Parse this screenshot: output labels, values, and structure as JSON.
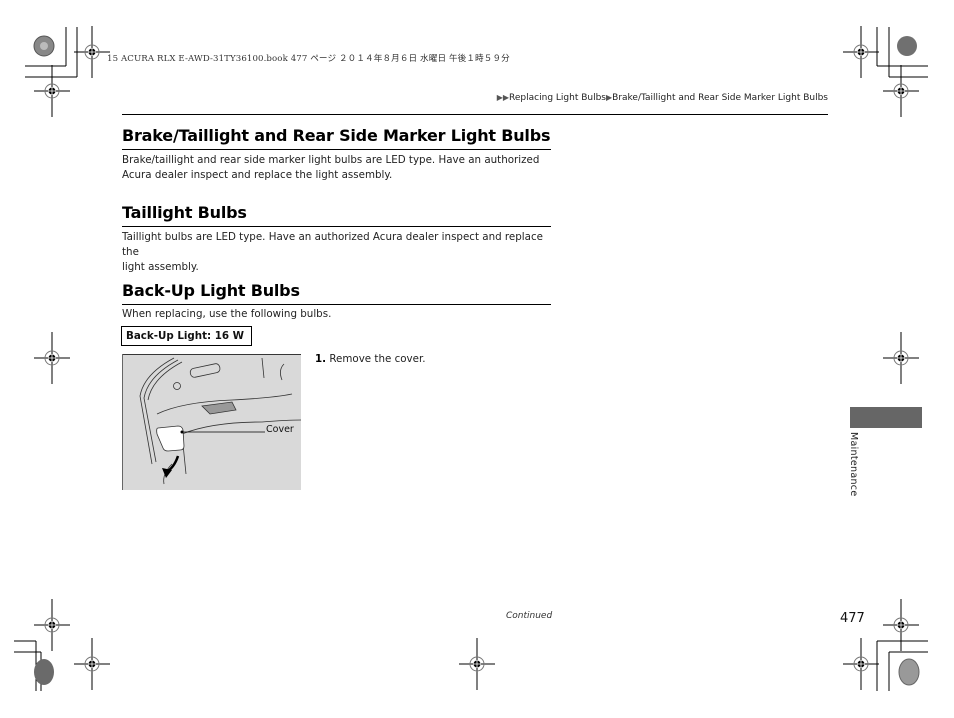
{
  "print_header": "15 ACURA RLX E-AWD-31TY36100.book  477 ページ  ２０１４年８月６日  水曜日  午後１時５９分",
  "breadcrumb": {
    "arrow_icon": "double-triangle-right",
    "items": [
      "Replacing Light Bulbs",
      "Brake/Taillight and Rear Side Marker Light Bulbs"
    ]
  },
  "sections": [
    {
      "title": "Brake/Taillight and Rear Side Marker Light Bulbs",
      "lines": [
        "Brake/taillight and rear side marker light bulbs are LED type. Have an authorized",
        "Acura dealer inspect and replace the light assembly."
      ]
    },
    {
      "title": "Taillight Bulbs",
      "lines": [
        "Taillight bulbs are LED type. Have an authorized Acura dealer inspect and replace the",
        "light assembly."
      ]
    },
    {
      "title": "Back-Up Light Bulbs",
      "lines": [
        "When replacing, use the following bulbs."
      ]
    }
  ],
  "spec_box": "Back-Up Light: 16 W",
  "figure": {
    "callout": "Cover",
    "background": "#d9d9d9"
  },
  "steps": [
    {
      "number": "1.",
      "text": " Remove the cover."
    }
  ],
  "side_tab": {
    "label": "Maintenance",
    "color": "#666666"
  },
  "footer": {
    "continued": "Continued",
    "page_number": "477"
  }
}
